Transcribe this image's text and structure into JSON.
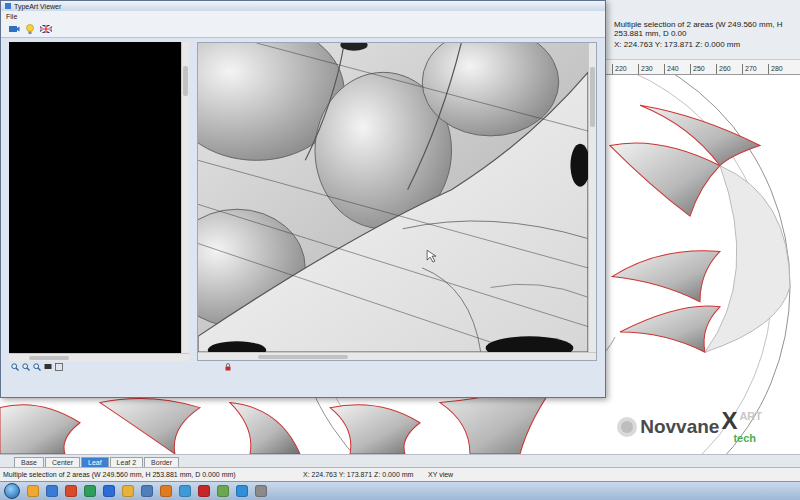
{
  "viewer": {
    "title": "TypeArt Viewer",
    "menu": [
      {
        "label": "File"
      }
    ]
  },
  "info": {
    "selection": "Multiple selection of 2 areas (W 249.560 mm, H 253.881 mm, D 0.00",
    "coords": "X: 224.763   Y: 173.871   Z: 0.000 mm"
  },
  "ruler": [
    "220",
    "230",
    "240",
    "250",
    "260",
    "270",
    "280"
  ],
  "layer_tabs": [
    {
      "label": "Base",
      "selected": false
    },
    {
      "label": "Center",
      "selected": false
    },
    {
      "label": "Leaf",
      "selected": true
    },
    {
      "label": "Leaf 2",
      "selected": false
    },
    {
      "label": "Border",
      "selected": false
    }
  ],
  "status_bar": {
    "selection": "Multiple selection of 2 areas (W 249.560 mm, H 253.881 mm, D 0.000 mm)",
    "coords": "X: 224.763  Y: 173.871  Z: 0.000 mm",
    "view": "XY view"
  },
  "watermark": {
    "brand": "Novvane",
    "mark": "X",
    "art": "ART",
    "sub": "tech"
  },
  "taskbar": {
    "apps": [
      {
        "color": "#f0a830"
      },
      {
        "color": "#3a7bd5"
      },
      {
        "color": "#d94a2b"
      },
      {
        "color": "#2f9e5a"
      },
      {
        "color": "#2b6cd9"
      },
      {
        "color": "#e8b23a"
      },
      {
        "color": "#4e7fb8"
      },
      {
        "color": "#e07b22"
      },
      {
        "color": "#3f9ad6"
      },
      {
        "color": "#c62828"
      },
      {
        "color": "#6aa84f"
      },
      {
        "color": "#2f8fd8"
      },
      {
        "color": "#8a8a8a"
      }
    ]
  }
}
